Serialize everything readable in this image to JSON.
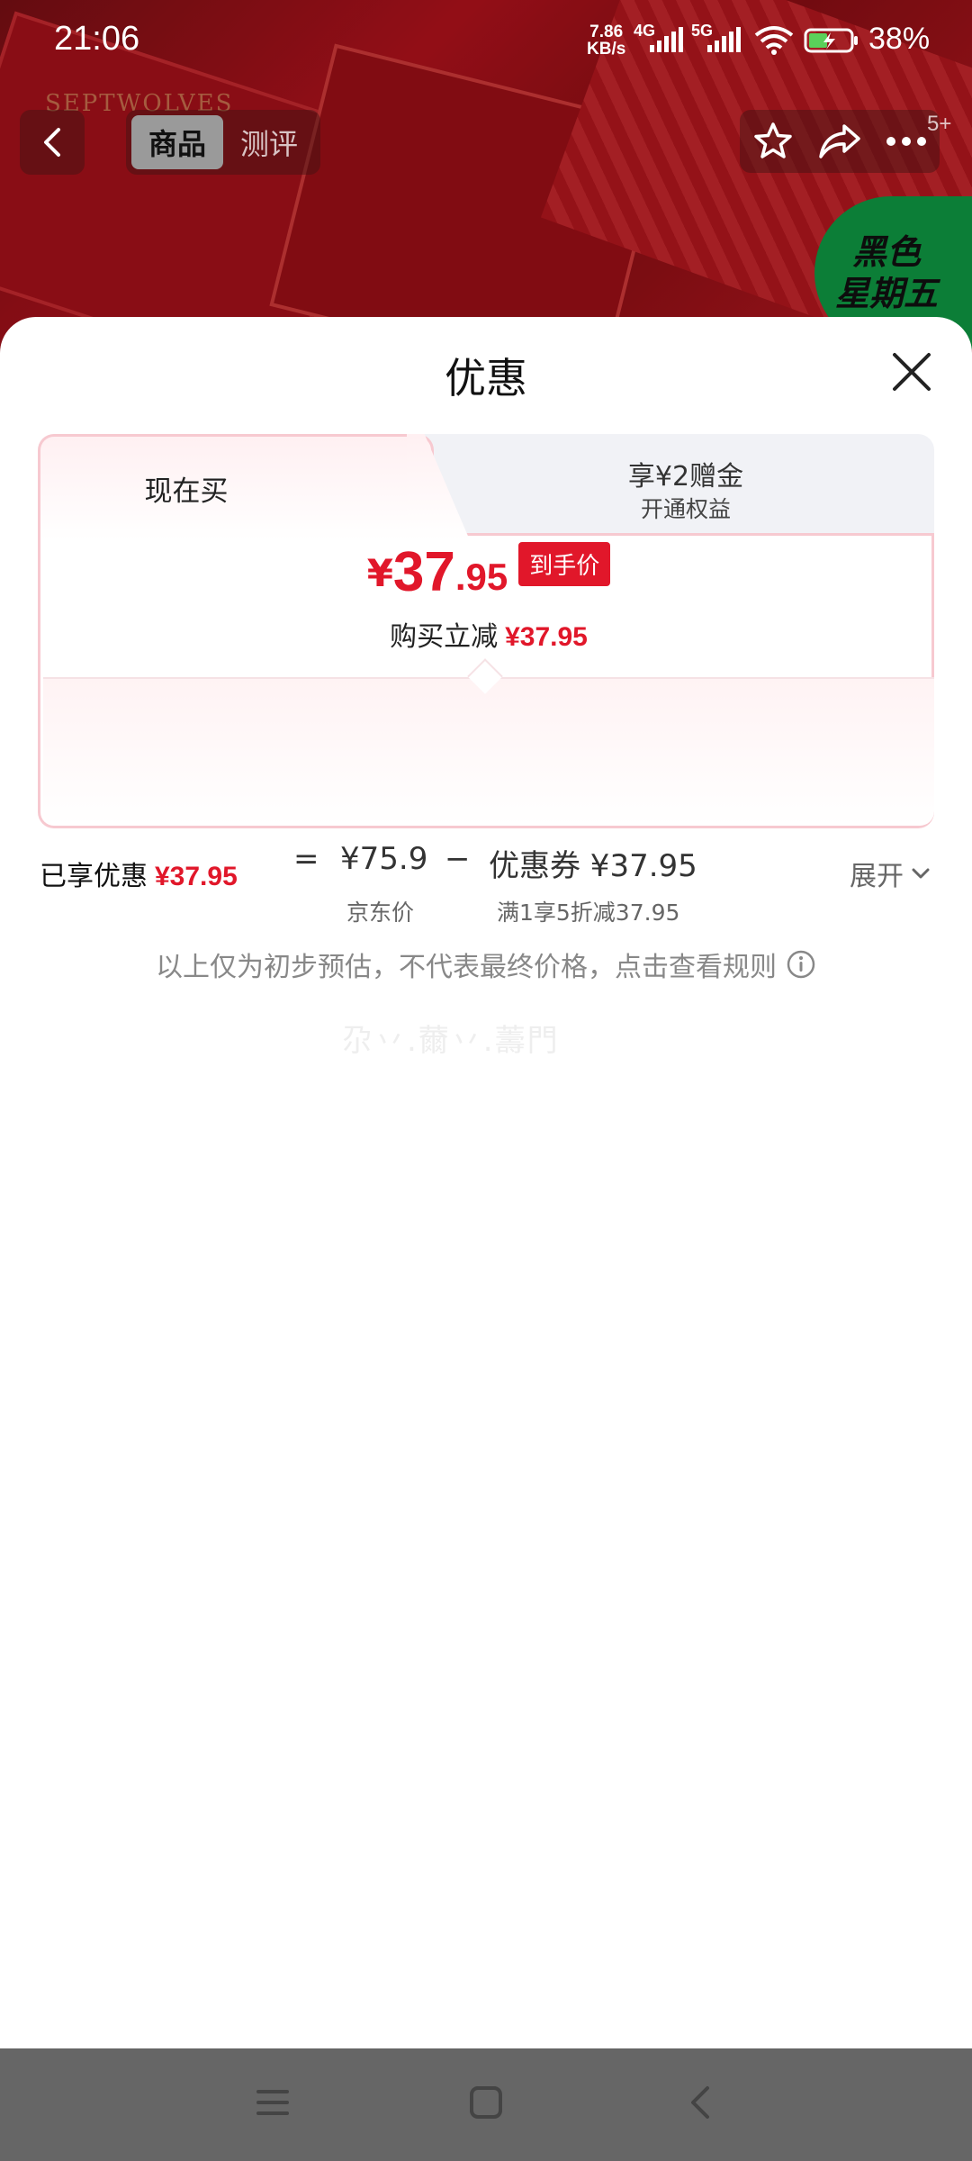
{
  "status_bar": {
    "time": "21:06",
    "net_speed_value": "7.86",
    "net_speed_unit": "KB/s",
    "network_1": "4G",
    "network_2": "5G",
    "battery_percent": "38%"
  },
  "product_bg": {
    "brand_text": "SEPTWOLVES",
    "promo_line1": "黑色",
    "promo_line2": "星期五"
  },
  "top_nav": {
    "tabs": [
      "商品",
      "测评"
    ],
    "active_tab": "商品",
    "badge": "5+"
  },
  "sheet": {
    "title": "优惠",
    "tab_now": "现在买",
    "tab_member_title": "享¥2赠金",
    "tab_member_sub": "开通权益",
    "final_price_yen": "¥",
    "final_price_int": "37",
    "final_price_dec": ".95",
    "final_price_tag": "到手价",
    "instant_discount_label": "购买立减",
    "instant_discount_value": "¥37.95",
    "breakdown": {
      "equals": "=",
      "jd_price": "¥75.9",
      "jd_price_label": "京东价",
      "minus": "−",
      "coupon": "优惠券 ¥37.95",
      "coupon_label": "满1享5折减37.95"
    },
    "enjoyed_label": "已享优惠",
    "enjoyed_value": "¥37.95",
    "expand_label": "展开",
    "disclaimer": "以上仅为初步预估，不代表最终价格，点击查看规则",
    "watermark": "尕丷.薾丷.薵門"
  },
  "colors": {
    "accent_red": "#e1172a",
    "card_border": "#f7c9d0",
    "promo_green": "#0f9a44",
    "navbar_gray": "#666666"
  },
  "icons": [
    "back-arrow-icon",
    "star-icon",
    "share-icon",
    "more-icon",
    "close-icon",
    "info-icon",
    "chevron-down-icon",
    "menu-icon",
    "home-icon",
    "back-icon"
  ]
}
